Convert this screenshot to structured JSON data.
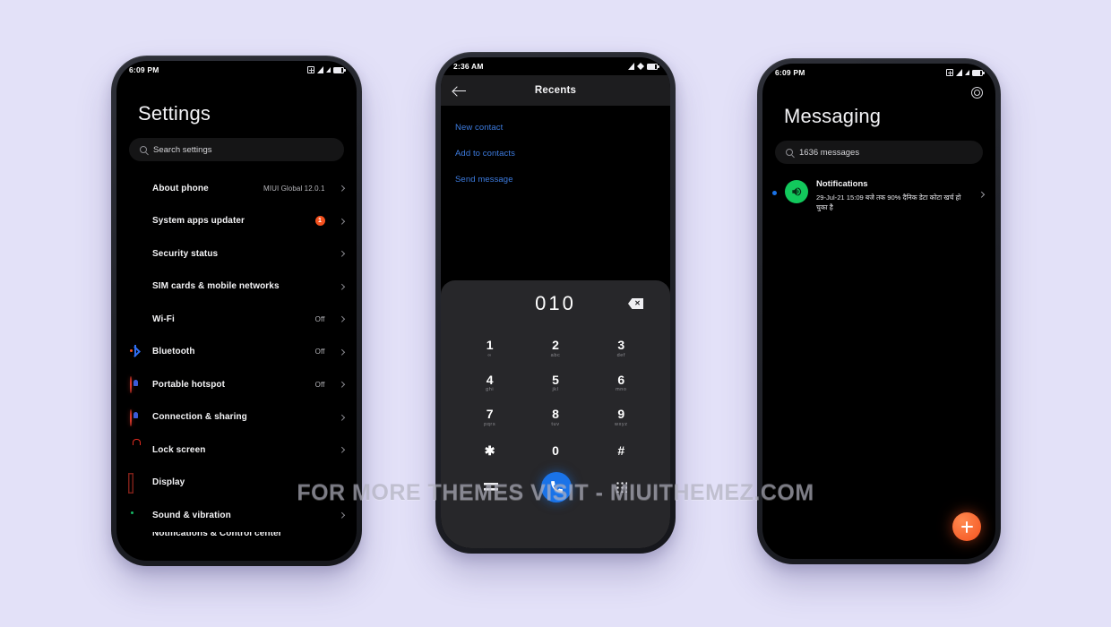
{
  "background_color": "#e3e1f8",
  "watermark": "FOR MORE THEMES VISIT - MIUITHEMEZ.COM",
  "phones": {
    "settings": {
      "status_bar": {
        "time": "6:09 PM",
        "icons": [
          "alarm-icon",
          "signal-icon",
          "signal-icon",
          "battery-icon"
        ]
      },
      "title": "Settings",
      "search": {
        "placeholder": "Search settings",
        "icon": "search-icon"
      },
      "items": [
        {
          "label": "About phone",
          "value": "MIUI Global 12.0.1",
          "icon": "phone-icon",
          "badge": ""
        },
        {
          "label": "System apps updater",
          "value": "",
          "icon": "update-arrow-icon",
          "badge": "1"
        },
        {
          "label": "Security status",
          "value": "",
          "icon": "shield-icon",
          "badge": ""
        },
        {
          "label": "SIM cards & mobile networks",
          "value": "",
          "icon": "sim-card-icon",
          "badge": ""
        },
        {
          "label": "Wi-Fi",
          "value": "Off",
          "icon": "wifi-icon",
          "badge": ""
        },
        {
          "label": "Bluetooth",
          "value": "Off",
          "icon": "bluetooth-icon",
          "badge": ""
        },
        {
          "label": "Portable hotspot",
          "value": "Off",
          "icon": "hotspot-icon",
          "badge": ""
        },
        {
          "label": "Connection & sharing",
          "value": "",
          "icon": "hotspot-icon",
          "badge": ""
        },
        {
          "label": "Lock screen",
          "value": "",
          "icon": "lock-icon",
          "badge": ""
        },
        {
          "label": "Display",
          "value": "",
          "icon": "brightness-icon",
          "badge": ""
        },
        {
          "label": "Sound & vibration",
          "value": "",
          "icon": "speaker-icon",
          "badge": ""
        },
        {
          "label": "Notifications & Control center",
          "value": "",
          "icon": "notification-icon",
          "badge": ""
        }
      ]
    },
    "dialer": {
      "status_bar": {
        "time": "2:36 AM",
        "icons": [
          "signal-icon",
          "wifi-icon",
          "battery-icon"
        ]
      },
      "appbar": {
        "title": "Recents",
        "back_icon": "back-arrow-icon"
      },
      "options": [
        "New contact",
        "Add to contacts",
        "Send message"
      ],
      "dialed_number": "010",
      "backspace_icon": "backspace-icon",
      "keypad": [
        [
          {
            "digit": "1",
            "sub": "∞"
          },
          {
            "digit": "2",
            "sub": "abc"
          },
          {
            "digit": "3",
            "sub": "def"
          }
        ],
        [
          {
            "digit": "4",
            "sub": "ghi"
          },
          {
            "digit": "5",
            "sub": "jkl"
          },
          {
            "digit": "6",
            "sub": "mno"
          }
        ],
        [
          {
            "digit": "7",
            "sub": "pqrs"
          },
          {
            "digit": "8",
            "sub": "tuv"
          },
          {
            "digit": "9",
            "sub": "wxyz"
          }
        ],
        [
          {
            "digit": "✱",
            "sub": ""
          },
          {
            "digit": "0",
            "sub": ""
          },
          {
            "digit": "#",
            "sub": ""
          }
        ]
      ],
      "actions": {
        "menu_icon": "menu-icon",
        "call_icon": "call-icon",
        "grid_icon": "dialpad-grid-icon"
      },
      "accent_color": "#1a73e8"
    },
    "messaging": {
      "status_bar": {
        "time": "6:09 PM",
        "icons": [
          "alarm-icon",
          "signal-icon",
          "signal-icon",
          "battery-icon"
        ]
      },
      "settings_icon": "gear-icon",
      "title": "Messaging",
      "search": {
        "placeholder": "1636 messages",
        "icon": "search-icon"
      },
      "conversations": [
        {
          "sender": "Notifications",
          "snippet": "29-Jul-21 15:09 बजे तक 90% दैनिक डेटा कोटा खर्च हो चुका है",
          "unread_dot": true,
          "avatar_icon": "speaker-icon",
          "avatar_color": "#12c85c",
          "chevron_icon": "chevron-right-icon"
        }
      ],
      "fab": {
        "icon": "plus-icon",
        "color": "#f4511e"
      }
    }
  }
}
